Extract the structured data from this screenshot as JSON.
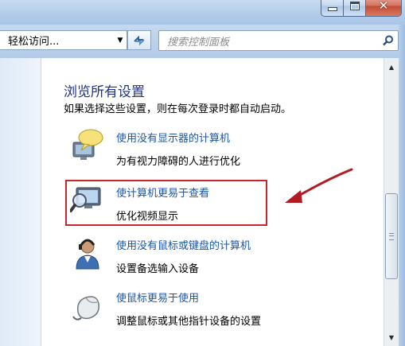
{
  "window": {
    "minimize_icon": "minimize-icon",
    "maximize_icon": "maximize-icon",
    "close_icon": "close-icon",
    "close_glyph": "✕"
  },
  "toolbar": {
    "address_text": "轻松访问...",
    "dropdown_glyph": "▼",
    "search_placeholder": "搜索控制面板"
  },
  "content": {
    "heading": "浏览所有设置",
    "subtext": "如果选择这些设置，则在每次登录时都自动启动。",
    "items": [
      {
        "title": "使用没有显示器的计算机",
        "desc": "为有视力障碍的人进行优化",
        "icon": "speech-bubble-monitor-icon"
      },
      {
        "title": "使计算机更易于查看",
        "desc": "优化视频显示",
        "icon": "magnifier-monitor-icon",
        "highlighted": true
      },
      {
        "title": "使用没有鼠标或键盘的计算机",
        "desc": "设置备选输入设备",
        "icon": "headset-person-icon"
      },
      {
        "title": "使鼠标更易于使用",
        "desc": "调整鼠标或其他指针设备的设置",
        "icon": "mouse-icon"
      }
    ]
  },
  "colors": {
    "heading": "#1e3287",
    "link": "#1a56a6",
    "annotation_red": "#c9232d"
  },
  "scrollbar": {
    "up_glyph": "▲",
    "down_glyph": "▼"
  }
}
